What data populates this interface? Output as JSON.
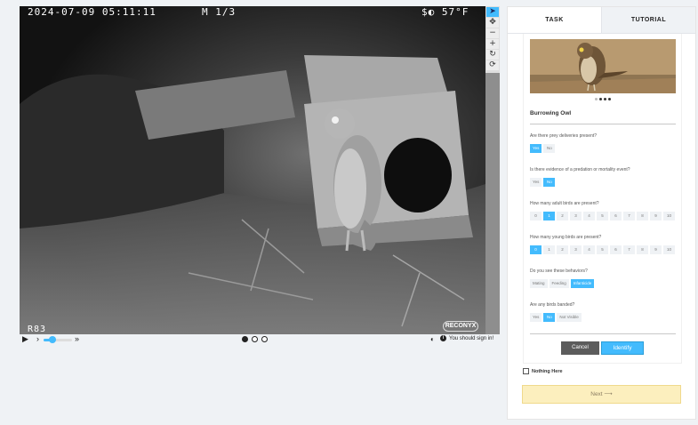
{
  "camera": {
    "timestamp": "2024-07-09 05:11:11",
    "frame_label": "M 1/3",
    "temperature": "57°F",
    "moon_icon": "moon-phase-icon",
    "camera_id": "R83",
    "brand": "RECONYX"
  },
  "tools": [
    {
      "name": "pointer-tool",
      "glyph": "➤",
      "active": true
    },
    {
      "name": "move-tool",
      "glyph": "✥",
      "active": false
    },
    {
      "name": "zoom-out-tool",
      "glyph": "−",
      "active": false
    },
    {
      "name": "zoom-in-tool",
      "glyph": "+",
      "active": false
    },
    {
      "name": "rotate-tool",
      "glyph": "↻",
      "active": false
    },
    {
      "name": "reset-tool",
      "glyph": "⟳",
      "active": false
    }
  ],
  "controls": {
    "play_icon": "▶",
    "prev_icon": "›",
    "fast_icon": "»",
    "speed_fraction": 0.3,
    "frame_count": 3,
    "current_frame": 1,
    "contrast_icon": "◐",
    "info_glyph": "i",
    "signin_text": "You should sign in!"
  },
  "tabs": [
    {
      "label": "TASK",
      "active": true
    },
    {
      "label": "TUTORIAL",
      "active": false
    }
  ],
  "species": {
    "name": "Burrowing Owl",
    "image_dots": 4,
    "image_current": 2
  },
  "questions": [
    {
      "label": "Are there prey deliveries present?",
      "options": [
        "Yes",
        "No"
      ],
      "selected": [
        0
      ]
    },
    {
      "label": "Is there evidence of a predation or mortality event?",
      "options": [
        "Yes",
        "No"
      ],
      "selected": [
        1
      ]
    },
    {
      "label": "How many adult birds are present?",
      "options": [
        "0",
        "1",
        "2",
        "3",
        "4",
        "5",
        "6",
        "7",
        "8",
        "9",
        "10"
      ],
      "selected": [
        1
      ]
    },
    {
      "label": "How many young birds are present?",
      "options": [
        "0",
        "1",
        "2",
        "3",
        "4",
        "5",
        "6",
        "7",
        "8",
        "9",
        "10"
      ],
      "selected": [
        0
      ]
    },
    {
      "label": "Do you see these behaviors?",
      "options": [
        "Mating",
        "Feeding",
        "Infanticide"
      ],
      "selected": [
        2
      ]
    },
    {
      "label": "Are any birds banded?",
      "options": [
        "Yes",
        "No",
        "Not Visible"
      ],
      "selected": [
        1
      ]
    }
  ],
  "buttons": {
    "cancel": "Cancel",
    "identify": "Identify",
    "nothing_here": "Nothing Here",
    "next": "Next ⟶"
  },
  "colors": {
    "accent": "#43bbfd",
    "next_bg": "#fcefbe"
  }
}
